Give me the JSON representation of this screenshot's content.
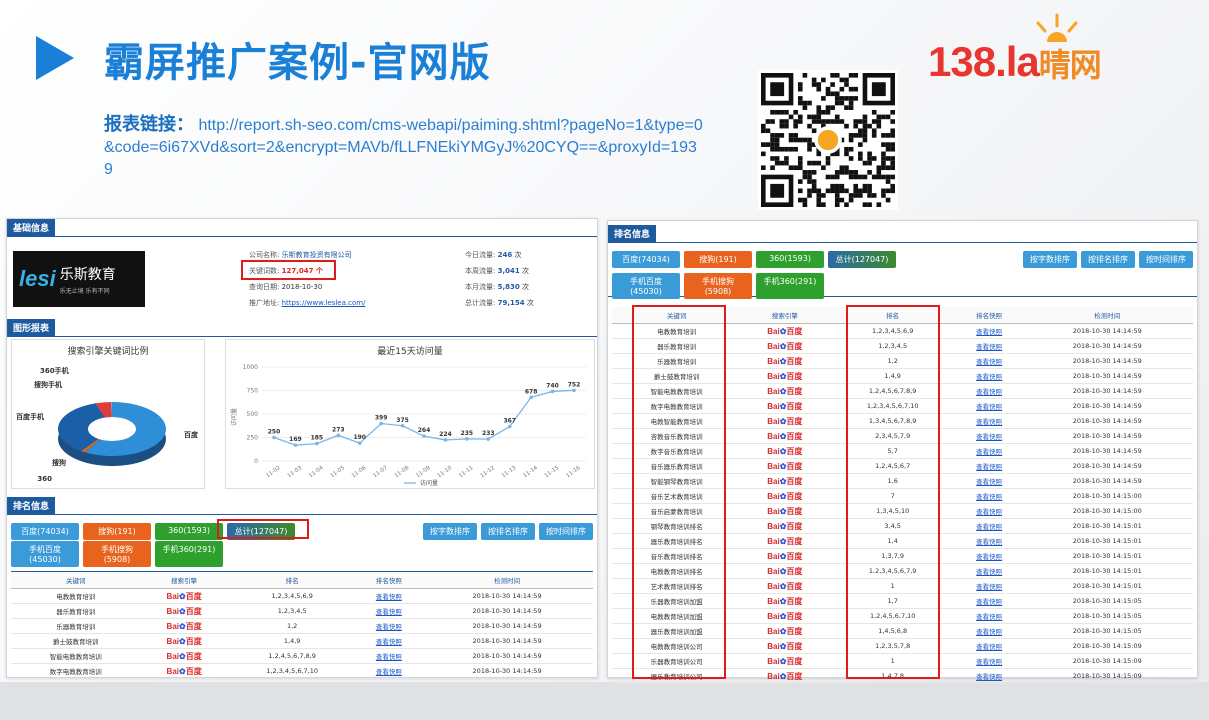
{
  "header": {
    "title": "霸屏推广案例-官网版",
    "report_label": "报表链接",
    "report_sep": "：",
    "report_url": "http://report.sh-seo.com/cms-webapi/paiming.shtml?pageNo=1&type=0&code=6i67XVd&sort=2&encrypt=MAVb/fLLFNEkiYMGyJ%20CYQ==&proxyId=1939",
    "brand_num": "138.la",
    "brand_cn": "晴网"
  },
  "left": {
    "basic_info_tab": "基础信息",
    "company_logo_text": "乐斯教育",
    "company_logo_word": "lesi",
    "company_slogan": "乐无止境 乐有不同",
    "info": [
      {
        "label": "公司名称:",
        "value": "乐斯教育投资有限公司"
      },
      {
        "label": "关键词数:",
        "value": "127,047 个"
      },
      {
        "label": "查询日期:",
        "value": "2018-10-30"
      },
      {
        "label": "推广地址:",
        "value": "https://www.leslea.com/"
      }
    ],
    "traffic": [
      {
        "label": "今日流量:",
        "value": "246",
        "unit": "次"
      },
      {
        "label": "本周流量:",
        "value": "3,041",
        "unit": "次"
      },
      {
        "label": "本月流量:",
        "value": "5,830",
        "unit": "次"
      },
      {
        "label": "总计流量:",
        "value": "79,154",
        "unit": "次"
      }
    ],
    "graph_tab": "图形报表",
    "rank_tab": "排名信息",
    "filters_row1": [
      "百度(74034)",
      "搜狗(191)",
      "360(1593)",
      "总计(127047)"
    ],
    "filters_row2": [
      "手机百度(45030)",
      "手机搜狗(5908)",
      "手机360(291)"
    ],
    "sort_buttons": [
      "按字数排序",
      "按排名排序",
      "按时间排序"
    ],
    "table_headers": [
      "关键词",
      "搜索引擎",
      "排名",
      "排名快照",
      "检测时间"
    ],
    "rows": [
      [
        "电教教育培训",
        "1,2,3,4,5,6,9",
        "2018-10-30 14:14:59"
      ],
      [
        "器乐教育培训",
        "1,2,3,4,5",
        "2018-10-30 14:14:59"
      ],
      [
        "乐器教育培训",
        "1,2",
        "2018-10-30 14:14:59"
      ],
      [
        "爵士鼓教育培训",
        "1,4,9",
        "2018-10-30 14:14:59"
      ],
      [
        "智能电教教育培训",
        "1,2,4,5,6,7,8,9",
        "2018-10-30 14:14:59"
      ],
      [
        "数字电教教育培训",
        "1,2,3,4,5,6,7,10",
        "2018-10-30 14:14:59"
      ]
    ]
  },
  "right": {
    "rank_tab": "排名信息",
    "filters_row1": [
      "百度(74034)",
      "搜狗(191)",
      "360(1593)",
      "总计(127047)"
    ],
    "filters_row2": [
      "手机百度(45030)",
      "手机搜狗(5908)",
      "手机360(291)"
    ],
    "sort_buttons": [
      "按字数排序",
      "按排名排序",
      "按时间排序"
    ],
    "table_headers": [
      "关键词",
      "搜索引擎",
      "排名",
      "排名快照",
      "检测时间"
    ],
    "snapshot_label": "查看快照",
    "rows": [
      [
        "电教教育培训",
        "1,2,3,4,5,6,9",
        "2018-10-30 14:14:59"
      ],
      [
        "器乐教育培训",
        "1,2,3,4,5",
        "2018-10-30 14:14:59"
      ],
      [
        "乐器教育培训",
        "1,2",
        "2018-10-30 14:14:59"
      ],
      [
        "爵士鼓教育培训",
        "1,4,9",
        "2018-10-30 14:14:59"
      ],
      [
        "智能电教教育培训",
        "1,2,4,5,6,7,8,9",
        "2018-10-30 14:14:59"
      ],
      [
        "数字电教教育培训",
        "1,2,3,4,5,6,7,10",
        "2018-10-30 14:14:59"
      ],
      [
        "电教智能教育培训",
        "1,3,4,5,6,7,8,9",
        "2018-10-30 14:14:59"
      ],
      [
        "咨教音乐教育培训",
        "2,3,4,5,7,9",
        "2018-10-30 14:14:59"
      ],
      [
        "数字音乐教育培训",
        "5,7",
        "2018-10-30 14:14:59"
      ],
      [
        "音乐器乐教育培训",
        "1,2,4,5,6,7",
        "2018-10-30 14:14:59"
      ],
      [
        "智能钢琴教育培训",
        "1,6",
        "2018-10-30 14:14:59"
      ],
      [
        "音乐艺术教育培训",
        "7",
        "2018-10-30 14:15:00"
      ],
      [
        "音乐启蒙教育培训",
        "1,3,4,5,10",
        "2018-10-30 14:15:00"
      ],
      [
        "钢琴教育培训排名",
        "3,4,5",
        "2018-10-30 14:15:01"
      ],
      [
        "器乐教育培训排名",
        "1,4",
        "2018-10-30 14:15:01"
      ],
      [
        "音乐教育培训排名",
        "1,3,7,9",
        "2018-10-30 14:15:01"
      ],
      [
        "电教教育培训排名",
        "1,2,3,4,5,6,7,9",
        "2018-10-30 14:15:01"
      ],
      [
        "艺术教育培训排名",
        "1",
        "2018-10-30 14:15:01"
      ],
      [
        "乐器教育培训加盟",
        "1,7",
        "2018-10-30 14:15:05"
      ],
      [
        "电教教育培训加盟",
        "1,2,4,5,6,7,10",
        "2018-10-30 14:15:05"
      ],
      [
        "器乐教育培训加盟",
        "1,4,5,6,8",
        "2018-10-30 14:15:05"
      ],
      [
        "电教教育培训公司",
        "1,2,3,5,7,8",
        "2018-10-30 14:15:09"
      ],
      [
        "乐器教育培训公司",
        "1",
        "2018-10-30 14:15:09"
      ],
      [
        "器乐教育培训公司",
        "1,4,7,8",
        "2018-10-30 14:15:09"
      ]
    ]
  },
  "chart_data": [
    {
      "type": "pie",
      "title": "搜索引擎关键词比例",
      "categories": [
        "百度",
        "搜狗",
        "360",
        "百度手机",
        "搜狗手机",
        "360手机"
      ],
      "values": [
        74034,
        191,
        1593,
        45030,
        5908,
        291
      ]
    },
    {
      "type": "line",
      "title": "最近15天访问量",
      "ylabel": "访问量",
      "categories": [
        "11-02",
        "11-03",
        "11-04",
        "11-05",
        "11-06",
        "11-07",
        "11-08",
        "11-09",
        "11-10",
        "11-11",
        "11-12",
        "11-13",
        "11-14",
        "11-15",
        "11-16"
      ],
      "series": [
        {
          "name": "访问量",
          "values": [
            250,
            169,
            185,
            273,
            190,
            399,
            375,
            264,
            224,
            235,
            233,
            367,
            678,
            740,
            752
          ]
        }
      ],
      "ylim": [
        0,
        1000
      ],
      "yticks": [
        "1000",
        "750",
        "500",
        "250",
        "0"
      ]
    }
  ],
  "colors": {
    "accent": "#1a7fd6",
    "highlight": "#e01b1b"
  }
}
